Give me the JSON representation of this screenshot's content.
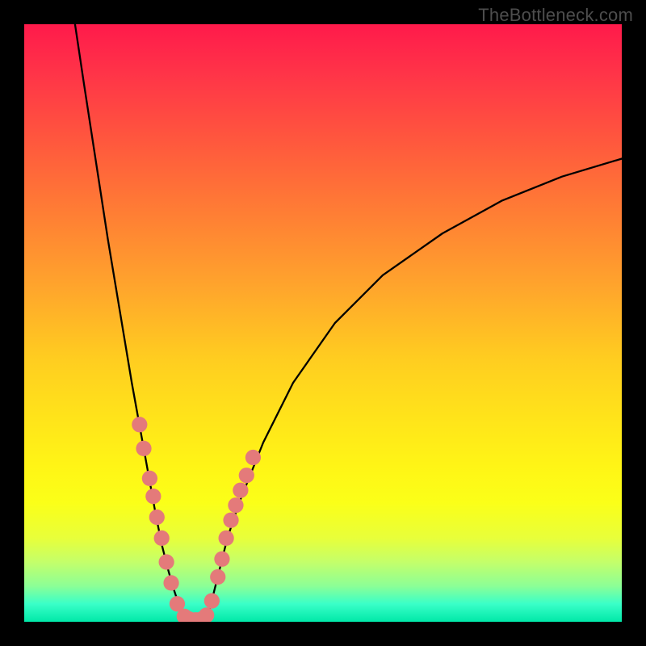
{
  "watermark": "TheBottleneck.com",
  "chart_data": {
    "type": "line",
    "title": "",
    "xlabel": "",
    "ylabel": "",
    "xlim": [
      0,
      100
    ],
    "ylim": [
      0,
      100
    ],
    "grid": false,
    "series": [
      {
        "name": "curve-left",
        "color": "#000000",
        "x": [
          8.5,
          10,
          12,
          14,
          16,
          18,
          20,
          22,
          23,
          24,
          25,
          26,
          26.8
        ],
        "y": [
          100,
          90,
          77,
          64,
          52,
          40,
          29,
          18,
          13,
          9,
          5.5,
          2.5,
          0.6
        ]
      },
      {
        "name": "curve-flat",
        "color": "#000000",
        "x": [
          26.8,
          27.5,
          28.5,
          29.5,
          30.3
        ],
        "y": [
          0.6,
          0.3,
          0.2,
          0.3,
          0.6
        ]
      },
      {
        "name": "curve-right",
        "color": "#000000",
        "x": [
          30.3,
          31,
          32,
          33,
          34,
          36,
          40,
          45,
          52,
          60,
          70,
          80,
          90,
          100
        ],
        "y": [
          0.6,
          2,
          6,
          10,
          14,
          20,
          30,
          40,
          50,
          58,
          65,
          70.5,
          74.5,
          77.5
        ]
      }
    ],
    "markers": {
      "name": "dots",
      "color": "#e47a7a",
      "radius_pct": 1.3,
      "points": [
        {
          "x": 19.3,
          "y": 33
        },
        {
          "x": 20.0,
          "y": 29
        },
        {
          "x": 21.0,
          "y": 24
        },
        {
          "x": 21.6,
          "y": 21
        },
        {
          "x": 22.2,
          "y": 17.5
        },
        {
          "x": 23.0,
          "y": 14
        },
        {
          "x": 23.8,
          "y": 10
        },
        {
          "x": 24.6,
          "y": 6.5
        },
        {
          "x": 25.6,
          "y": 3
        },
        {
          "x": 26.8,
          "y": 0.9
        },
        {
          "x": 27.6,
          "y": 0.45
        },
        {
          "x": 28.7,
          "y": 0.3
        },
        {
          "x": 29.7,
          "y": 0.45
        },
        {
          "x": 30.5,
          "y": 1.1
        },
        {
          "x": 31.4,
          "y": 3.5
        },
        {
          "x": 32.4,
          "y": 7.5
        },
        {
          "x": 33.1,
          "y": 10.5
        },
        {
          "x": 33.8,
          "y": 14
        },
        {
          "x": 34.6,
          "y": 17
        },
        {
          "x": 35.4,
          "y": 19.5
        },
        {
          "x": 36.2,
          "y": 22
        },
        {
          "x": 37.2,
          "y": 24.5
        },
        {
          "x": 38.3,
          "y": 27.5
        }
      ]
    }
  }
}
